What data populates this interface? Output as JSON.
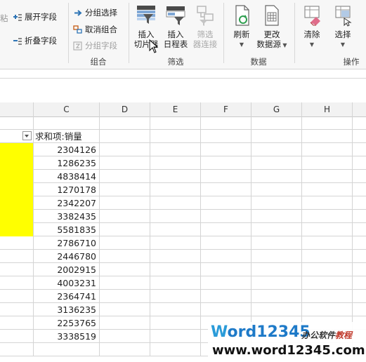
{
  "ribbon": {
    "left_partial": "粘",
    "expand_field": "展开字段",
    "collapse_field": "折叠字段",
    "group_selection": "分组选择",
    "ungroup": "取消组合",
    "group_field": "分组字段",
    "group_label": "组合",
    "insert_slicer_l1": "插入",
    "insert_slicer_l2": "切片器",
    "insert_timeline_l1": "插入",
    "insert_timeline_l2": "日程表",
    "filter_conn_l1": "筛选",
    "filter_conn_l2": "器连接",
    "filter_label": "筛选",
    "refresh": "刷新",
    "change_source_l1": "更改",
    "change_source_l2": "数据源",
    "data_label": "数据",
    "clear": "清除",
    "select": "选择",
    "actions_label": "操作"
  },
  "columns": [
    "C",
    "D",
    "E",
    "F",
    "G",
    "H"
  ],
  "pivot": {
    "header": "求和项:销量",
    "values": [
      "2304126",
      "1286235",
      "4838414",
      "1270178",
      "2342207",
      "3382435",
      "5581835",
      "2786710",
      "2446780",
      "2002915",
      "4003231",
      "2364741",
      "3136235",
      "2253765",
      "3338519"
    ]
  },
  "colors": {
    "highlight": "#ffff00",
    "ribbon_bg": "#f7f7f7",
    "grid_line": "#d4d4d4"
  },
  "watermark": {
    "brand_w": "W",
    "brand_rest": "ord12345",
    "cn_black": "办公软件",
    "cn_red": "教程",
    "url": "www.word12345.com"
  }
}
